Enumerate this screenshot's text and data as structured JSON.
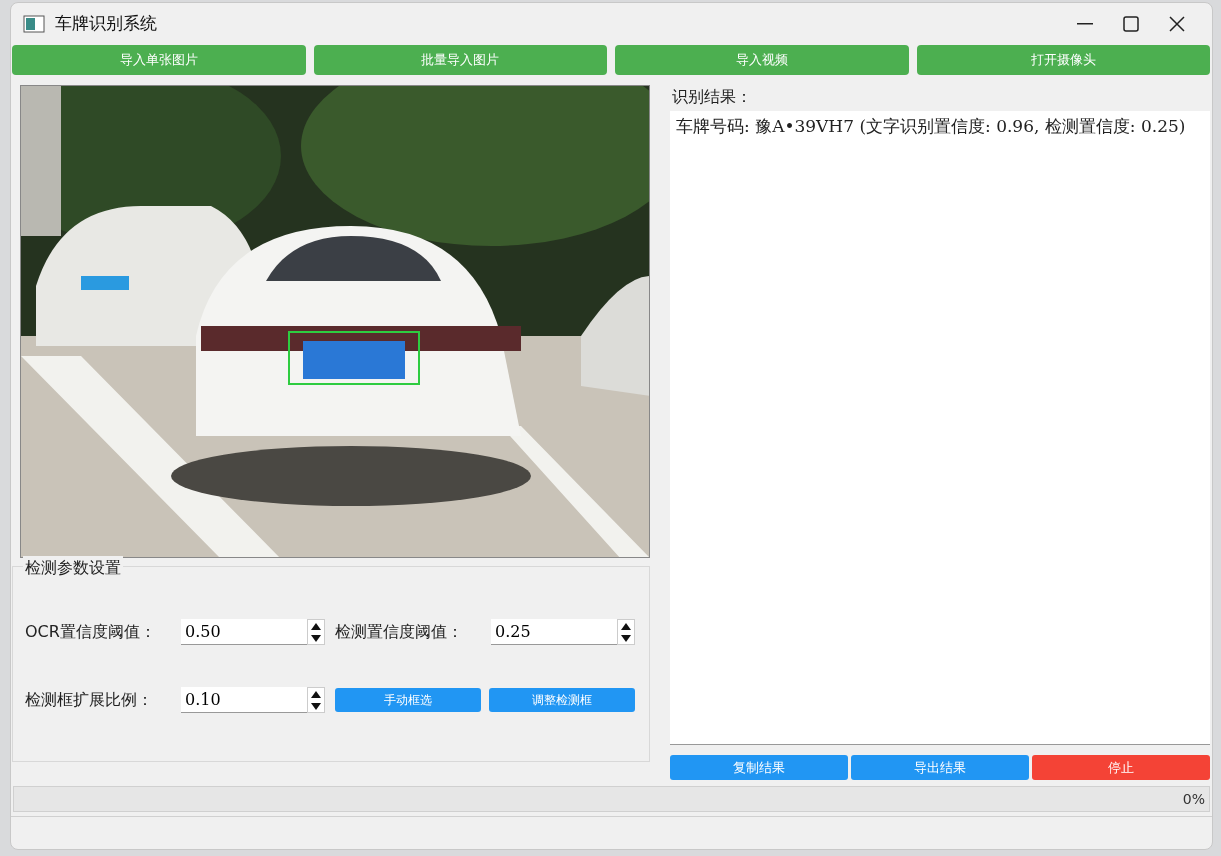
{
  "window": {
    "title": "车牌识别系统"
  },
  "toolbar": [
    {
      "label": "导入单张图片"
    },
    {
      "label": "批量导入图片"
    },
    {
      "label": "导入视频"
    },
    {
      "label": "打开摄像头"
    }
  ],
  "params": {
    "title": "检测参数设置",
    "fields": [
      {
        "label": "OCR置信度阈值：",
        "value": "0.50"
      },
      {
        "label": "检测置信度阈值：",
        "value": "0.25"
      },
      {
        "label": "检测框扩展比例：",
        "value": "0.10"
      }
    ],
    "buttons": [
      "手动框选",
      "调整检测框"
    ]
  },
  "result": {
    "label": "识别结果：",
    "text": "车牌号码: 豫A•39VH7 (文字识别置信度: 0.96, 检测置信度: 0.25)"
  },
  "actions": [
    {
      "label": "复制结果",
      "kind": "normal"
    },
    {
      "label": "导出结果",
      "kind": "normal"
    },
    {
      "label": "停止",
      "kind": "danger"
    }
  ],
  "progress": {
    "level": 0,
    "reading": "0%"
  }
}
